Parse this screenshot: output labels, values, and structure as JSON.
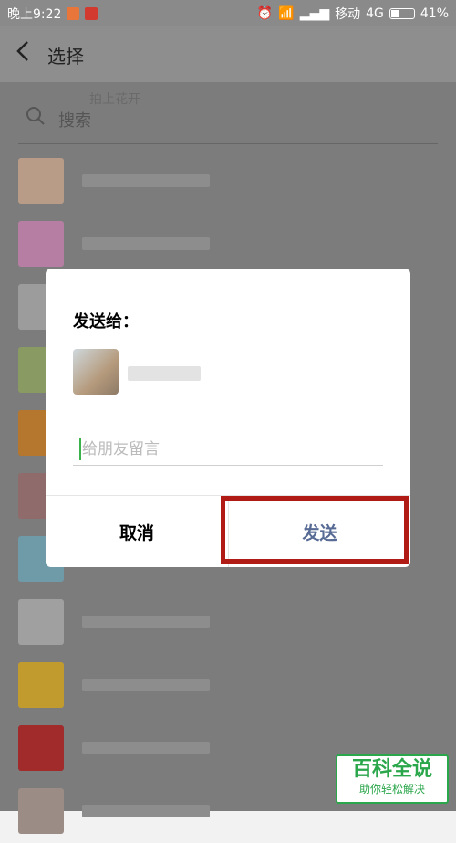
{
  "status_bar": {
    "time": "晚上9:22",
    "carrier": "移动",
    "network": "4G",
    "battery": "41%",
    "battery_level": 0.41
  },
  "header": {
    "title": "选择"
  },
  "search": {
    "ghost_label": "拍上花开",
    "placeholder": "搜索"
  },
  "contacts": [
    {
      "avatar_color": "#b99c87"
    },
    {
      "avatar_color": "#b77ea4"
    },
    {
      "avatar_color": "#9c9c9c"
    },
    {
      "avatar_color": "#8a9a63"
    },
    {
      "avatar_color": "#b5762e"
    },
    {
      "avatar_color": "#8f6b6b"
    },
    {
      "avatar_color": "#6f9aa8"
    },
    {
      "avatar_color": "#a0a0a0"
    },
    {
      "avatar_color": "#c29b2f"
    },
    {
      "avatar_color": "#a12a2a"
    },
    {
      "avatar_color": "#9b8d86"
    }
  ],
  "dialog": {
    "heading": "发送给：",
    "message_placeholder": "给朋友留言",
    "cancel_label": "取消",
    "send_label": "发送"
  },
  "watermark": {
    "title": "百科全说",
    "subtitle": "助你轻松解决"
  },
  "colors": {
    "send_accent": "#576b95",
    "highlight_border": "#b01c15",
    "watermark_green": "#2aa64b"
  }
}
